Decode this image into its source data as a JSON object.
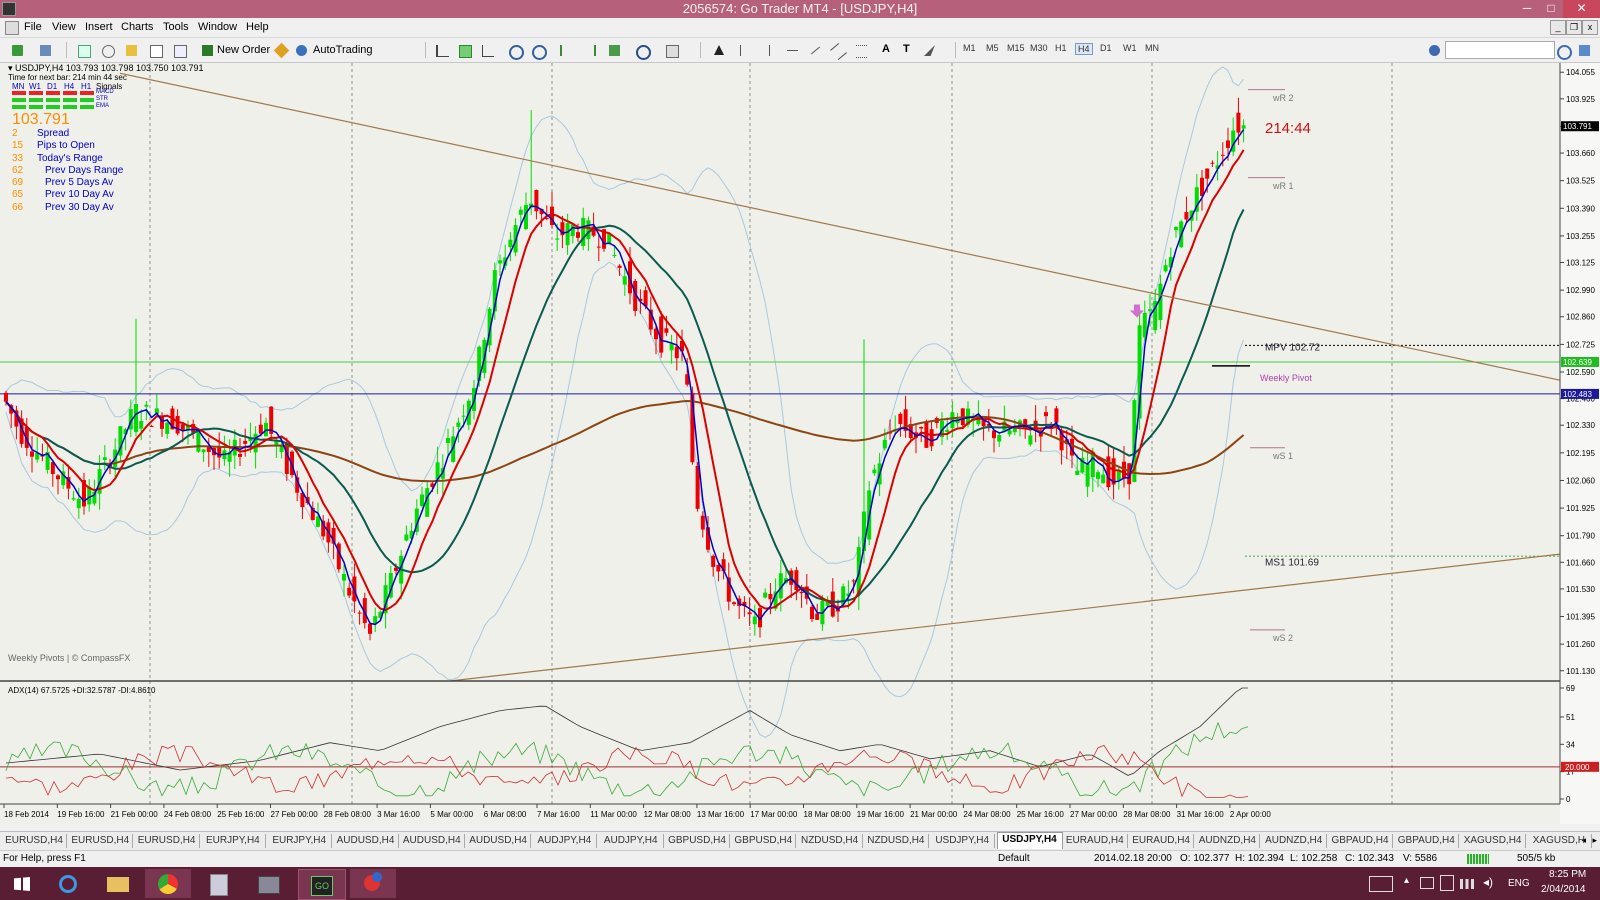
{
  "window": {
    "title": "2056574: Go Trader MT4 - [USDJPY,H4]",
    "controls": [
      "─",
      "□",
      "✕"
    ],
    "mdi_controls": [
      "_",
      "❐",
      "x"
    ]
  },
  "menu": [
    "File",
    "View",
    "Insert",
    "Charts",
    "Tools",
    "Window",
    "Help"
  ],
  "toolbar": {
    "new_order": "New Order",
    "autotrading": "AutoTrading",
    "timeframes": [
      "M1",
      "M5",
      "M15",
      "M30",
      "H1",
      "H4",
      "D1",
      "W1",
      "MN"
    ],
    "active_timeframe": "H4"
  },
  "chart": {
    "header": "USDJPY,H4  103.793 103.798 103.750 103.791",
    "timer": "Time for next bar: 214 min 44 sec",
    "signals_header": [
      "MN",
      "W1",
      "D1",
      "H4",
      "H1",
      "Signals"
    ],
    "signal_rows": [
      "MACD",
      "STR",
      "EMA"
    ],
    "price_big": "103.791",
    "stats": [
      {
        "value": "2",
        "label": "Spread"
      },
      {
        "value": "15",
        "label": "Pips to Open"
      },
      {
        "value": "33",
        "label": "Today's Range"
      },
      {
        "value": "62",
        "label": "Prev Days Range"
      },
      {
        "value": "69",
        "label": "Prev 5 Days Av"
      },
      {
        "value": "65",
        "label": "Prev 10 Day Av"
      },
      {
        "value": "66",
        "label": "Prev 30 Day Av"
      }
    ],
    "countdown": "214:44",
    "weekly_pivots_credit": "Weekly Pivots | © CompassFX",
    "pivot_labels": {
      "wr2": "wR 2",
      "wr1": "wR 1",
      "mpv": "MPV   102.72",
      "weekly_pivot": "Weekly Pivot",
      "ws1": "wS 1",
      "ms1": "MS1   101.69",
      "ws2": "wS 2"
    },
    "price_axis": [
      "104.055",
      "103.925",
      "103.790",
      "103.660",
      "103.525",
      "103.390",
      "103.255",
      "103.125",
      "102.990",
      "102.860",
      "102.725",
      "102.590",
      "102.460",
      "102.330",
      "102.195",
      "102.060",
      "101.925",
      "101.790",
      "101.660",
      "101.530",
      "101.395",
      "101.260",
      "101.130"
    ],
    "price_markers": {
      "current": "103.791",
      "green": "102.639",
      "blue": "102.483"
    },
    "time_axis": [
      "18 Feb 2014",
      "19 Feb 16:00",
      "21 Feb 00:00",
      "24 Feb 08:00",
      "25 Feb 16:00",
      "27 Feb 00:00",
      "28 Feb 08:00",
      "3 Mar 16:00",
      "5 Mar 00:00",
      "6 Mar 08:00",
      "7 Mar 16:00",
      "11 Mar 00:00",
      "12 Mar 08:00",
      "13 Mar 16:00",
      "17 Mar 00:00",
      "18 Mar 08:00",
      "19 Mar 16:00",
      "21 Mar 00:00",
      "24 Mar 08:00",
      "25 Mar 16:00",
      "27 Mar 00:00",
      "28 Mar 08:00",
      "31 Mar 16:00",
      "2 Apr 00:00"
    ],
    "colors": {
      "bull": "#00dd00",
      "bear": "#ee0000",
      "fast_ma": "#0000cc",
      "mid_ma": "#dd0000",
      "slow_ma": "#0a5a50",
      "long_ma": "#8b4513",
      "bands": "#a8c8e0",
      "trendline": "#a0784c"
    }
  },
  "adx": {
    "label": "ADX(14) 67.5725 +DI:32.5787 -DI:4.8610",
    "axis": [
      "69",
      "51",
      "34",
      "17",
      "0"
    ],
    "level_marker": "20.000"
  },
  "tabs": [
    "EURUSD,H4",
    "EURUSD,H4",
    "EURUSD,H4",
    "EURJPY,H4",
    "EURJPY,H4",
    "AUDUSD,H4",
    "AUDUSD,H4",
    "AUDUSD,H4",
    "AUDJPY,H4",
    "AUDJPY,H4",
    "GBPUSD,H4",
    "GBPUSD,H4",
    "NZDUSD,H4",
    "NZDUSD,H4",
    "USDJPY,H4",
    "USDJPY,H4",
    "EURAUD,H4",
    "EURAUD,H4",
    "AUDNZD,H4",
    "AUDNZD,H4",
    "GBPAUD,H4",
    "GBPAUD,H4",
    "XAGUSD,H4",
    "XAGUSD,H"
  ],
  "active_tab": 15,
  "status": {
    "help": "For Help, press F1",
    "profile": "Default",
    "datetime": "2014.02.18 20:00",
    "open": "O: 102.377",
    "high": "H: 102.394",
    "low": "L: 102.258",
    "close": "C: 102.343",
    "volume": "V: 5586",
    "traffic": "505/5 kb"
  },
  "taskbar": {
    "lang": "ENG",
    "time": "8:25 PM",
    "date": "2/04/2014"
  }
}
